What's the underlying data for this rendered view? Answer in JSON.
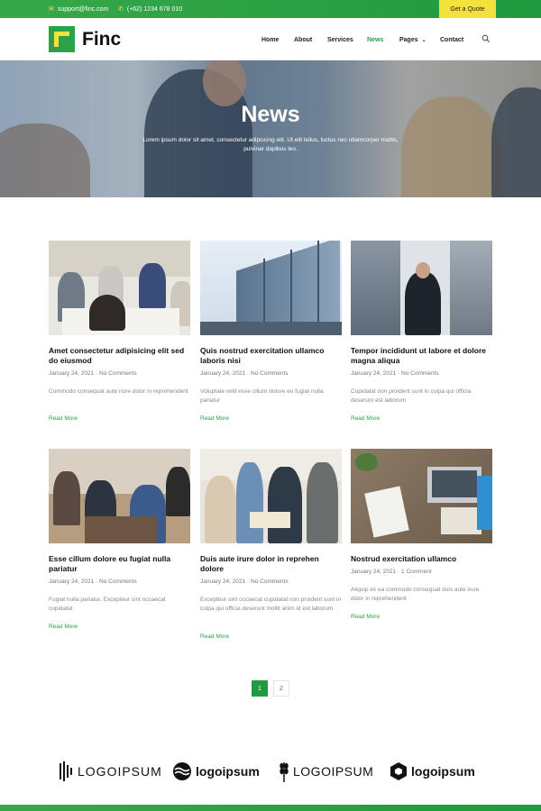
{
  "topbar": {
    "email": "support@finc.com",
    "phone": "(+62) 1234 678 010",
    "quote_button": "Get a Quote"
  },
  "header": {
    "brand": "Finc",
    "nav": [
      {
        "label": "Home"
      },
      {
        "label": "About"
      },
      {
        "label": "Services"
      },
      {
        "label": "News"
      },
      {
        "label": "Pages"
      },
      {
        "label": "Contact"
      }
    ],
    "active_nav": "News"
  },
  "hero": {
    "title": "News",
    "subtitle": "Lorem ipsum dolor sit amet, consectetur adipiscing elit. Ut elit tellus, luctus nec ullamcorper mattis, pulvinar dapibus leo."
  },
  "posts": [
    {
      "title": "Amet consectetur adipisicing elit sed do eiusmod",
      "date": "January 24, 2021",
      "comments": "No Comments",
      "excerpt": "Commodo consequat aute irure dolor in reprehenderit",
      "read_more": "Read More"
    },
    {
      "title": "Quis nostrud exercitation ullamco laboris nisi",
      "date": "January 24, 2021",
      "comments": "No Comments",
      "excerpt": "Voluptate velit esse cillum dolore eu fugiat nulla pariatur",
      "read_more": "Read More"
    },
    {
      "title": "Tempor incididunt ut labore et dolore magna aliqua",
      "date": "January 24, 2021",
      "comments": "No Comments",
      "excerpt": "Cupidatat non proident sunt in culpa qui officia deserunt est laborum",
      "read_more": "Read More"
    },
    {
      "title": "Esse cillum dolore eu fugiat nulla pariatur",
      "date": "January 24, 2021",
      "comments": "No Comments",
      "excerpt": "Fugiat nulla pariatur. Excepteur sint occaecat cupidatat",
      "read_more": "Read More"
    },
    {
      "title": "Duis aute irure dolor in reprehen dolore",
      "date": "January 24, 2021",
      "comments": "No Comments",
      "excerpt": "Excepteur sint occaecat cupidatat non proident sunt in culpa qui officia deserunt mollit anim id est laborum",
      "read_more": "Read More"
    },
    {
      "title": "Nostrud exercitation ullamco",
      "date": "January 24, 2021",
      "comments": "1 Comment",
      "excerpt": "Aliquip ex ea commodo consequat duis aute irure dolor in reprehenderit",
      "read_more": "Read More"
    }
  ],
  "pagination": {
    "pages": [
      "1",
      "2"
    ],
    "current": "1"
  },
  "partners": [
    {
      "name": "LOGOIPSUM",
      "icon": "bars-logo-icon"
    },
    {
      "name": "logoipsum",
      "icon": "waves-logo-icon"
    },
    {
      "name": "LOGOIPSUM",
      "icon": "wheat-logo-icon"
    },
    {
      "name": "logoipsum",
      "icon": "hexagon-logo-icon"
    }
  ],
  "colors": {
    "brand_green": "#2aa24a",
    "accent_yellow": "#f5e13c"
  }
}
